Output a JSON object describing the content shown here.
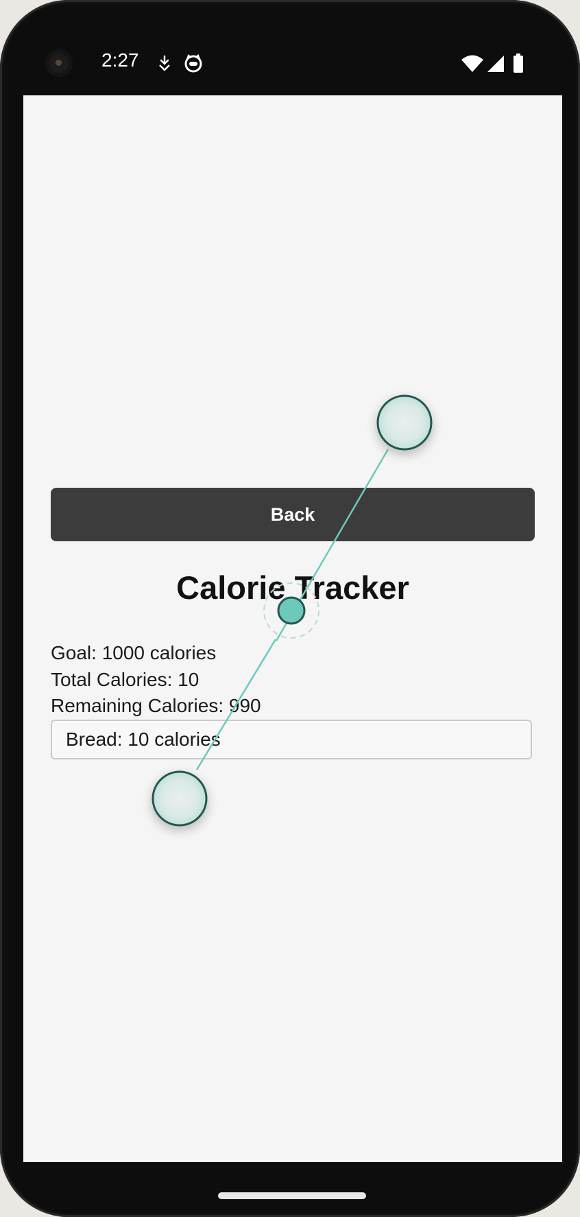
{
  "status_bar": {
    "time": "2:27",
    "icons": [
      "download-icon",
      "cat-face-icon",
      "wifi-icon",
      "signal-icon",
      "battery-icon"
    ]
  },
  "screen": {
    "back_label": "Back",
    "title": "Calorie Tracker",
    "goal_text": "Goal: 1000 calories",
    "total_text": "Total Calories: 10",
    "remaining_text": "Remaining Calories: 990",
    "food_items": [
      {
        "label": "Bread: 10 calories"
      }
    ]
  },
  "colors": {
    "accent": "#6cc9bc",
    "button_bg": "#3c3c3c",
    "screen_bg": "#f5f5f5"
  }
}
